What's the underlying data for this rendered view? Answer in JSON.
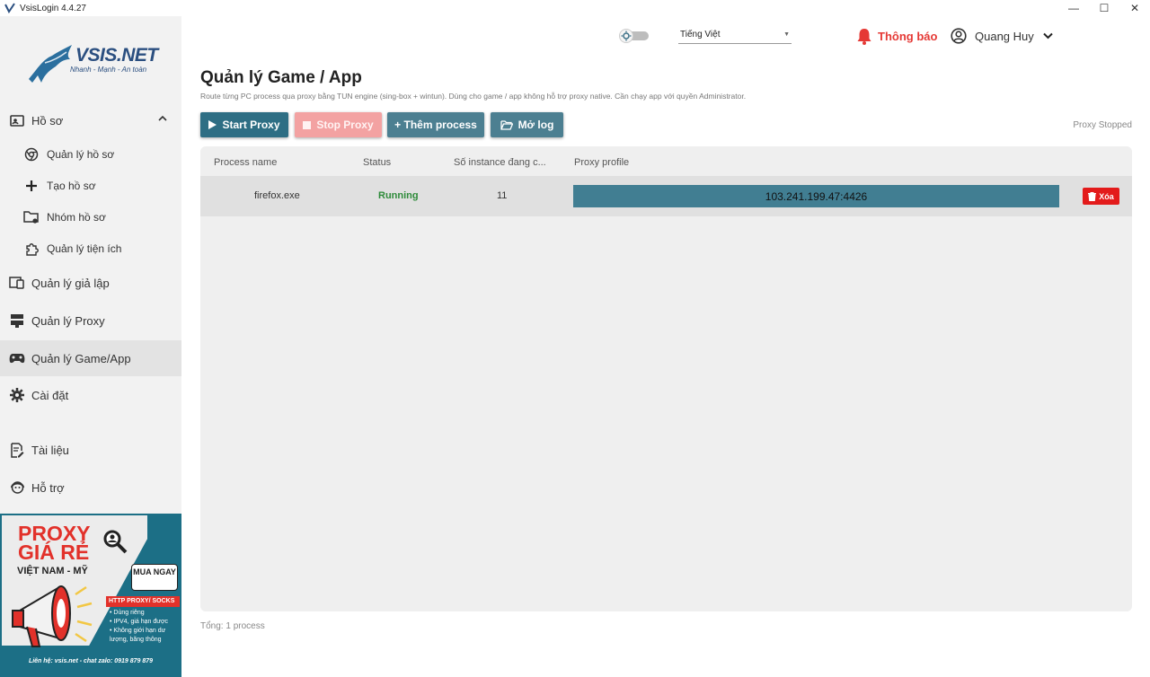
{
  "window": {
    "title": "VsisLogin 4.4.27",
    "minimize": "—",
    "maximize": "☐",
    "close": "✕"
  },
  "brand": {
    "name": "VSIS.NET",
    "tagline": "Nhanh - Mạnh - An toàn"
  },
  "sidebar": {
    "items": [
      {
        "label": "Hồ sơ"
      },
      {
        "label": "Quản lý hồ sơ"
      },
      {
        "label": "Tạo hồ sơ"
      },
      {
        "label": "Nhóm hồ sơ"
      },
      {
        "label": "Quản lý tiện ích"
      },
      {
        "label": "Quản lý giả lập"
      },
      {
        "label": "Quản lý Proxy"
      },
      {
        "label": "Quản lý Game/App"
      },
      {
        "label": "Cài đặt"
      },
      {
        "label": "Tài liệu"
      },
      {
        "label": "Hỗ trợ"
      }
    ]
  },
  "ad": {
    "line1": "PROXY",
    "line2": "GIÁ RẺ",
    "line3": "VIỆT NAM - MỸ",
    "buy": "MUA NGAY",
    "banner": "HTTP PROXY/ SOCKS",
    "bullets": [
      "• Dùng riêng",
      "• IPV4, giá hạn được",
      "• Không giới hạn dư",
      "lượng, băng thông"
    ],
    "footer": "Liên hệ: vsis.net - chat zalo: 0919 879 879"
  },
  "header": {
    "language": "Tiếng Việt",
    "notifications": "Thông báo",
    "user_name": "Quang Huy"
  },
  "main": {
    "title": "Quản lý Game / App",
    "description": "Route từng PC process qua proxy bằng TUN engine (sing-box + wintun). Dùng cho game / app không hỗ trợ proxy native. Cần chạy app với quyền Administrator.",
    "buttons": {
      "start": "Start Proxy",
      "stop": "Stop Proxy",
      "add": "+ Thêm process",
      "log": "Mở log"
    },
    "proxy_status": "Proxy Stopped",
    "table": {
      "headers": [
        "Process name",
        "Status",
        "Số instance đang c...",
        "Proxy profile"
      ],
      "rows": [
        {
          "process": "firefox.exe",
          "status": "Running",
          "instances": "11",
          "proxy": "103.241.199.47:4426",
          "delete": "Xóa"
        }
      ]
    },
    "total": "Tổng: 1 process"
  },
  "colors": {
    "accent": "#2e6e84",
    "danger": "#e31b1b",
    "running": "#2e8b3a",
    "notify": "#e53935"
  }
}
